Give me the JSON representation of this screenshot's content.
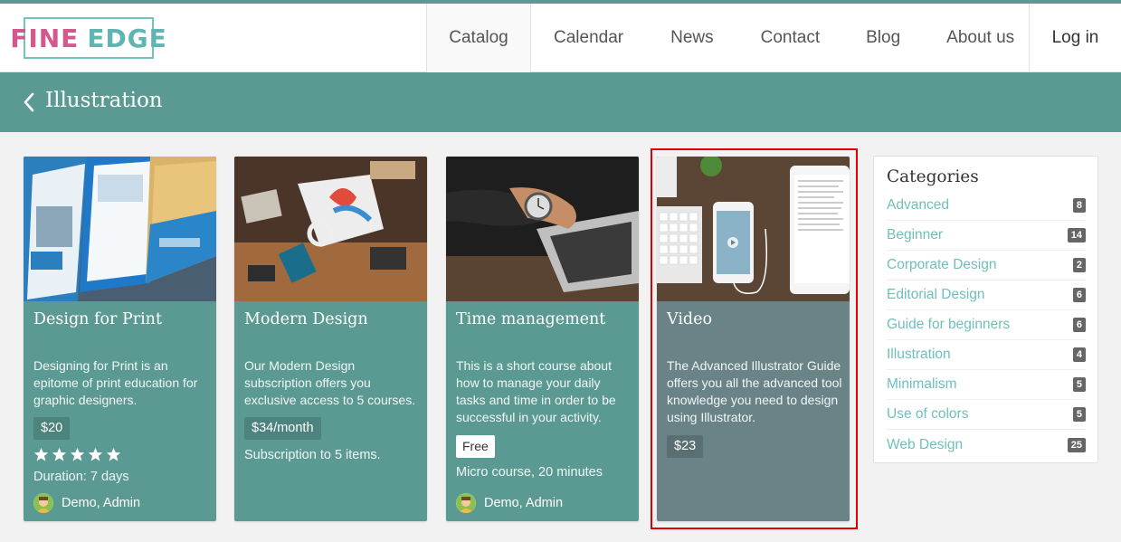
{
  "brand": {
    "word1": "FINE",
    "word2": "EDGE"
  },
  "nav": {
    "items": [
      {
        "label": "Catalog"
      },
      {
        "label": "Calendar"
      },
      {
        "label": "News"
      },
      {
        "label": "Contact"
      },
      {
        "label": "Blog"
      },
      {
        "label": "About us"
      }
    ],
    "login": "Log in"
  },
  "page": {
    "title": "Illustration"
  },
  "courses": [
    {
      "title": "Design for Print",
      "description": "Designing for Print is an epitome of print education for graphic designers.",
      "price": "$20",
      "rating": 5,
      "duration": "Duration: 7 days",
      "authors": "Demo, Admin"
    },
    {
      "title": "Modern Design",
      "description": "Our Modern Design subscription offers you exclusive access to 5 courses.",
      "price": "$34/month",
      "subscription": "Subscription to 5 items."
    },
    {
      "title": "Time management",
      "description": "This is a short course about how to manage your daily tasks and time in order to be successful in your activity.",
      "price": "Free",
      "format": "Micro course, 20 minutes",
      "authors": "Demo, Admin"
    },
    {
      "title": "Video",
      "description": "The Advanced Illustrator Guide offers you all the advanced tool knowledge you need to design using Illustrator.",
      "price": "$23"
    }
  ],
  "sidebar": {
    "title": "Categories",
    "categories": [
      {
        "name": "Advanced",
        "count": "8"
      },
      {
        "name": "Beginner",
        "count": "14"
      },
      {
        "name": "Corporate Design",
        "count": "2"
      },
      {
        "name": "Editorial Design",
        "count": "6"
      },
      {
        "name": "Guide for beginners",
        "count": "6"
      },
      {
        "name": "Illustration",
        "count": "4"
      },
      {
        "name": "Minimalism",
        "count": "5"
      },
      {
        "name": "Use of colors",
        "count": "5"
      },
      {
        "name": "Web Design",
        "count": "25"
      }
    ]
  },
  "colors": {
    "accent": "#5b9a93",
    "pink": "#d2588d",
    "link": "#6fbfba",
    "highlight": "#e00000"
  }
}
